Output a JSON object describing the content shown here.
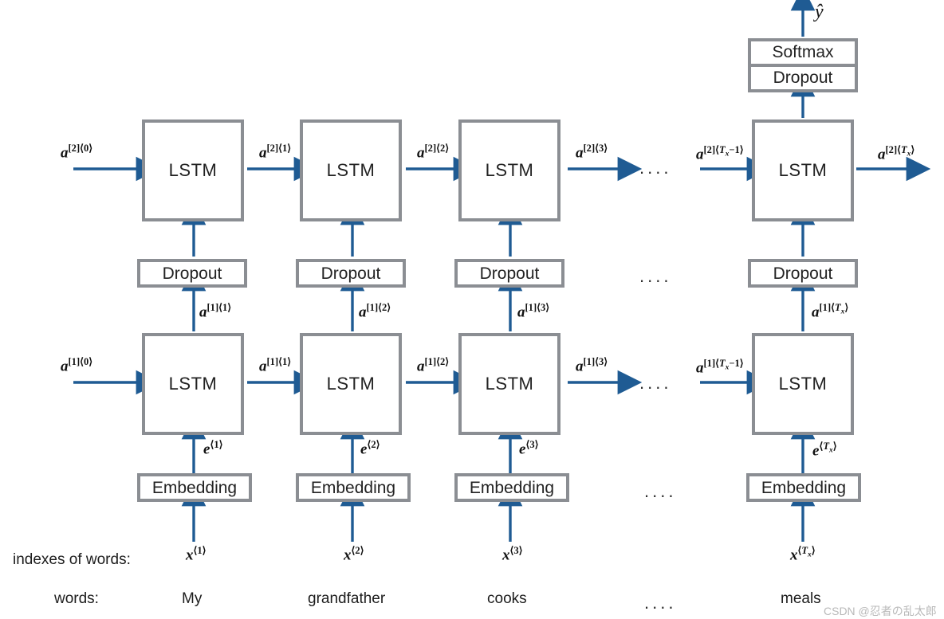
{
  "diagram": {
    "title": "Two-layer LSTM language model with dropout and softmax",
    "accent_color": "#1f5b93",
    "box_border_color": "#8b8e93",
    "ellipsis": "....",
    "output_label": "ŷ",
    "row_labels": {
      "indexes": "indexes of words:",
      "words": "words:"
    },
    "block_labels": {
      "lstm": "LSTM",
      "dropout": "Dropout",
      "embedding": "Embedding",
      "softmax": "Softmax"
    },
    "watermark": "CSDN @忍者の乱太郎",
    "columns": [
      {
        "id": "t1",
        "word": "My",
        "x_label": {
          "base": "x",
          "sup": "⟨1⟩"
        },
        "e_label": {
          "base": "e",
          "sup": "⟨1⟩"
        },
        "a1_in": {
          "base": "a",
          "sup": "[1]⟨0⟩"
        },
        "a1_out": {
          "base": "a",
          "sup": "[1]⟨1⟩"
        },
        "a1_up": {
          "base": "a",
          "sup": "[1]⟨1⟩"
        },
        "a2_in": {
          "base": "a",
          "sup": "[2]⟨0⟩"
        },
        "a2_out": {
          "base": "a",
          "sup": "[2]⟨1⟩"
        }
      },
      {
        "id": "t2",
        "word": "grandfather",
        "x_label": {
          "base": "x",
          "sup": "⟨2⟩"
        },
        "e_label": {
          "base": "e",
          "sup": "⟨2⟩"
        },
        "a1_in": {
          "base": "a",
          "sup": "[1]⟨1⟩"
        },
        "a1_out": {
          "base": "a",
          "sup": "[1]⟨2⟩"
        },
        "a1_up": {
          "base": "a",
          "sup": "[1]⟨2⟩"
        },
        "a2_in": {
          "base": "a",
          "sup": "[2]⟨1⟩"
        },
        "a2_out": {
          "base": "a",
          "sup": "[2]⟨2⟩"
        }
      },
      {
        "id": "t3",
        "word": "cooks",
        "x_label": {
          "base": "x",
          "sup": "⟨3⟩"
        },
        "e_label": {
          "base": "e",
          "sup": "⟨3⟩"
        },
        "a1_in": {
          "base": "a",
          "sup": "[1]⟨2⟩"
        },
        "a1_out": {
          "base": "a",
          "sup": "[1]⟨3⟩"
        },
        "a1_up": {
          "base": "a",
          "sup": "[1]⟨3⟩"
        },
        "a2_in": {
          "base": "a",
          "sup": "[2]⟨2⟩"
        },
        "a2_out": {
          "base": "a",
          "sup": "[2]⟨3⟩"
        }
      },
      {
        "id": "tx",
        "word": "meals",
        "x_label": {
          "base": "x",
          "sup": "⟨Tx⟩"
        },
        "e_label": {
          "base": "e",
          "sup": "⟨Tx⟩"
        },
        "a1_in": {
          "base": "a",
          "sup": "[1]⟨Tx−1⟩"
        },
        "a1_out": {
          "base": "a",
          "sup": "[1]⟨Tx⟩"
        },
        "a1_up": {
          "base": "a",
          "sup": "[1]⟨Tx⟩"
        },
        "a2_in": {
          "base": "a",
          "sup": "[2]⟨Tx−1⟩"
        },
        "a2_out": {
          "base": "a",
          "sup": "[2]⟨Tx⟩"
        }
      }
    ]
  }
}
